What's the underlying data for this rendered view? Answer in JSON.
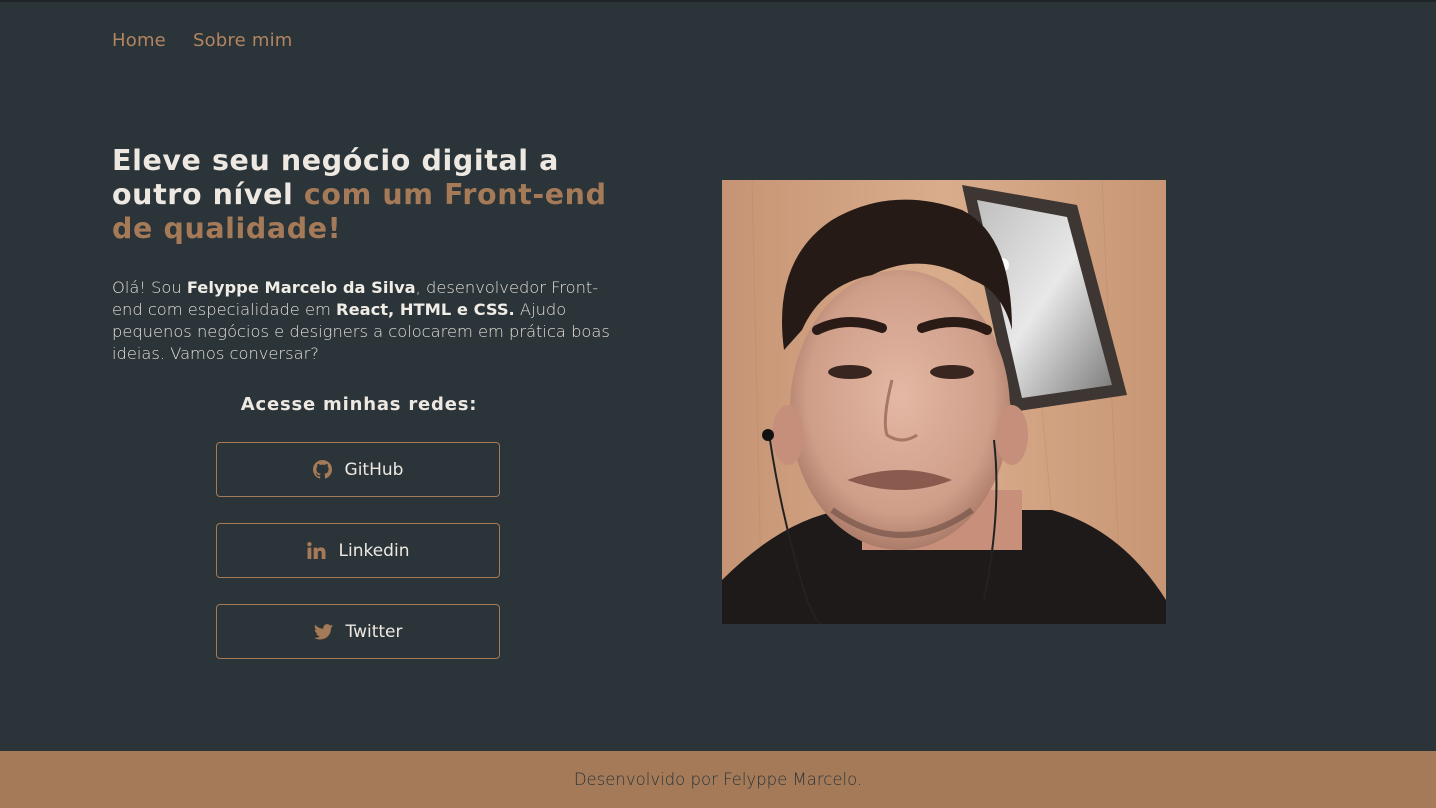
{
  "nav": {
    "items": [
      {
        "label": "Home"
      },
      {
        "label": "Sobre mim"
      }
    ]
  },
  "hero": {
    "title_part1": "Eleve seu negócio digital a outro nível ",
    "title_part2": "com um Front-end de qualidade!",
    "intro_1": "Olá! Sou ",
    "intro_name": "Felyppe Marcelo da Silva",
    "intro_2": ", desenvolvedor Front-end com especialidade em ",
    "intro_skills": "React, HTML e CSS.",
    "intro_3": " Ajudo pequenos negócios e designers a colocarem em prática boas ideias. Vamos conversar?"
  },
  "social": {
    "title": "Acesse minhas redes:",
    "links": [
      {
        "label": "GitHub",
        "icon": "github-icon"
      },
      {
        "label": "Linkedin",
        "icon": "linkedin-icon"
      },
      {
        "label": "Twitter",
        "icon": "twitter-icon"
      }
    ]
  },
  "photo": {
    "icon": "profile-photo"
  },
  "footer": {
    "text": "Desenvolvido por Felyppe Marcelo."
  },
  "colors": {
    "background": "#2b3438",
    "accent": "#a57a58",
    "text": "#ede9e2",
    "footer_text": "#2b3438"
  }
}
